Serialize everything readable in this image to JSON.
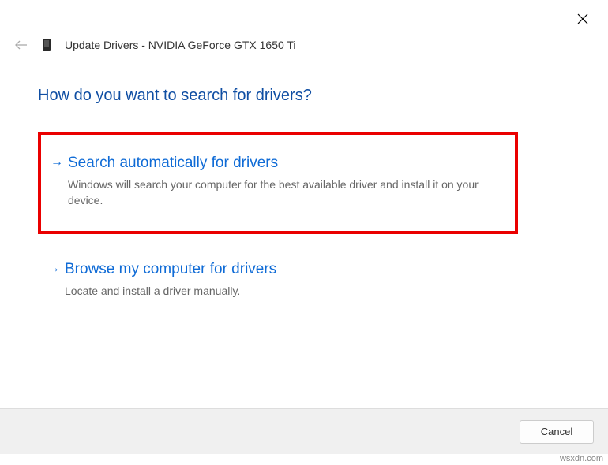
{
  "header": {
    "title": "Update Drivers - NVIDIA GeForce GTX 1650 Ti"
  },
  "heading": "How do you want to search for drivers?",
  "options": {
    "search_auto": {
      "title": "Search automatically for drivers",
      "desc": "Windows will search your computer for the best available driver and install it on your device."
    },
    "browse": {
      "title": "Browse my computer for drivers",
      "desc": "Locate and install a driver manually."
    }
  },
  "footer": {
    "cancel": "Cancel"
  },
  "watermark": "wsxdn.com"
}
